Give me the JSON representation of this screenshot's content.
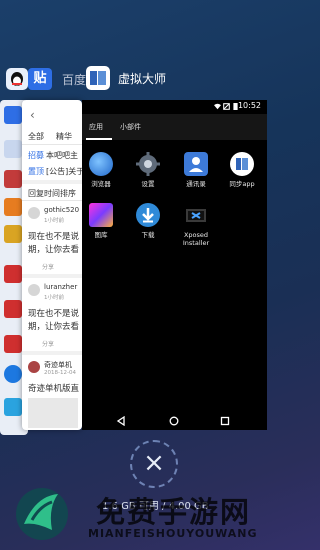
{
  "recents": {
    "back_app": {
      "title": "百度"
    },
    "tieba_card": {
      "tabs": [
        "全部",
        "精华"
      ],
      "top_items": [
        {
          "tag": "招募",
          "text": "本吧吧主"
        },
        {
          "tag": "置顶",
          "text": "[公告]关于"
        }
      ],
      "sort_label": "回复时间排序",
      "posts": [
        {
          "user": "gothic520",
          "time": "1小时前",
          "text_line1": "现在也不是说",
          "text_line2": "期，让你去看",
          "share": "分享"
        },
        {
          "user": "luranzher",
          "time": "1小时前",
          "text_line1": "现在也不是说",
          "text_line2": "期，让你去看",
          "share": "分享"
        },
        {
          "user": "奇迹单机",
          "time": "2018-12-04",
          "text_line1": "奇迹单机版直"
        }
      ]
    },
    "main_app": {
      "title": "虚拟大师",
      "status_time": "10:52",
      "tabs": [
        "应用",
        "小部件"
      ],
      "apps": [
        {
          "label": "浏览器",
          "icon": "browser-globe-icon",
          "color": "#2f7be0"
        },
        {
          "label": "设置",
          "icon": "settings-gear-icon",
          "color": "#5f6b7a"
        },
        {
          "label": "通讯录",
          "icon": "contacts-icon",
          "color": "#3d7ad8"
        },
        {
          "label": "同步app",
          "icon": "sync-app-icon",
          "color": "#ffffff"
        },
        {
          "label": "图库",
          "icon": "gallery-icon",
          "color": "#e05a9a"
        },
        {
          "label": "下载",
          "icon": "download-icon",
          "color": "#2f8ad8"
        },
        {
          "label": "Xposed Installer",
          "icon": "xposed-installer-icon",
          "color": "#3a3a3a"
        }
      ]
    },
    "close_all": {
      "icon": "close-icon"
    },
    "memory_text": "1.6 GB 可用 / 4.00 GB"
  },
  "watermark": {
    "title": "免费手游网",
    "subtitle": "MIANFEISHOUYOUWANG"
  }
}
